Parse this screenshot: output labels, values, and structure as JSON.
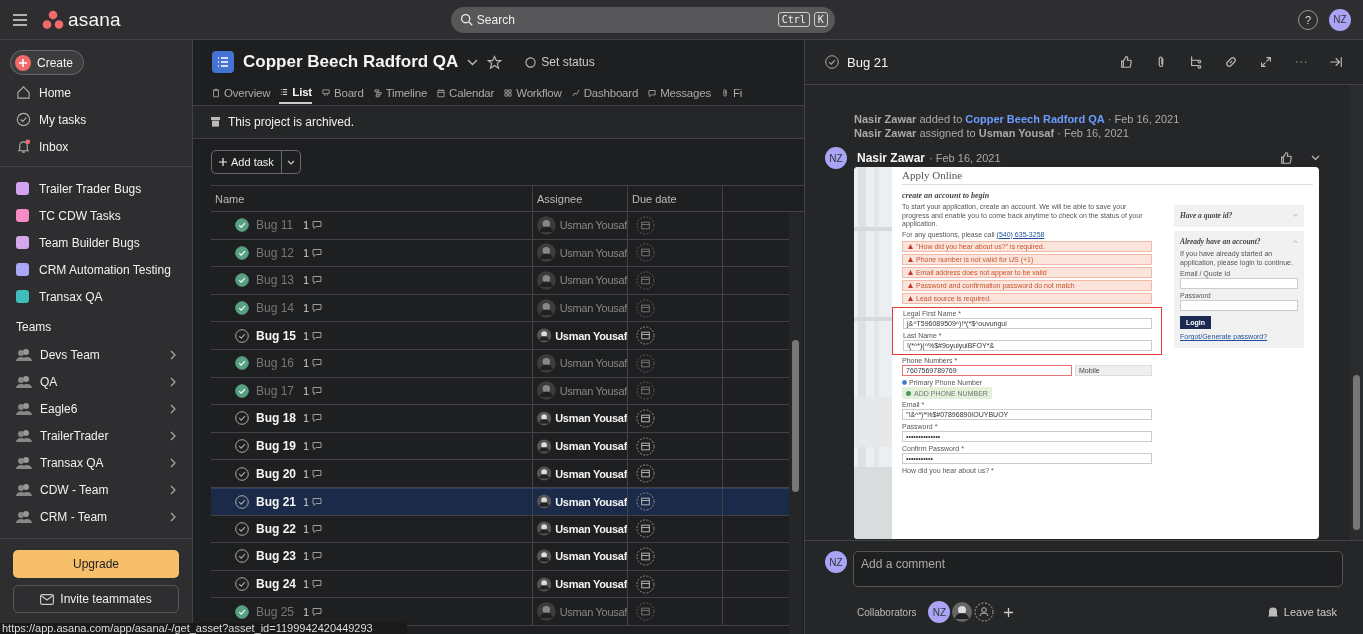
{
  "topbar": {
    "brand": "asana",
    "search_placeholder": "Search",
    "keys": [
      "Ctrl",
      "K"
    ],
    "help": "?",
    "user_initials": "NZ"
  },
  "sidebar": {
    "create": "Create",
    "nav": [
      {
        "label": "Home",
        "unread": false
      },
      {
        "label": "My tasks",
        "unread": false
      },
      {
        "label": "Inbox",
        "unread": true
      }
    ],
    "projects": [
      {
        "label": "Trailer Trader Bugs",
        "color": "#d3a4f2"
      },
      {
        "label": "TC CDW Tasks",
        "color": "#f78bc4"
      },
      {
        "label": "Team Builder Bugs",
        "color": "#d6a6ea"
      },
      {
        "label": "CRM Automation Testing",
        "color": "#a9a8f7"
      },
      {
        "label": "Transax QA",
        "color": "#3fbdbd"
      }
    ],
    "teams_heading": "Teams",
    "teams": [
      "Devs Team",
      "QA",
      "Eagle6",
      "TrailerTrader",
      "Transax QA",
      "CDW - Team",
      "CRM - Team"
    ],
    "upgrade": "Upgrade",
    "invite": "Invite teammates"
  },
  "project": {
    "title": "Copper Beech Radford QA",
    "status": "Set status",
    "tabs": [
      {
        "label": "Overview",
        "selected": false
      },
      {
        "label": "List",
        "selected": true
      },
      {
        "label": "Board",
        "selected": false
      },
      {
        "label": "Timeline",
        "selected": false
      },
      {
        "label": "Calendar",
        "selected": false
      },
      {
        "label": "Workflow",
        "selected": false
      },
      {
        "label": "Dashboard",
        "selected": false
      },
      {
        "label": "Messages",
        "selected": false
      },
      {
        "label": "Fi",
        "selected": false
      }
    ],
    "banner": "This project is archived.",
    "add_task": "Add task"
  },
  "table": {
    "columns": [
      "Name",
      "Assignee",
      "Due date"
    ],
    "rows": [
      {
        "name": "Bug 11",
        "completed": true,
        "comments": "1",
        "assignee": "Usman Yousaf",
        "selected": false
      },
      {
        "name": "Bug 12",
        "completed": true,
        "comments": "1",
        "assignee": "Usman Yousaf",
        "selected": false
      },
      {
        "name": "Bug 13",
        "completed": true,
        "comments": "1",
        "assignee": "Usman Yousaf",
        "selected": false
      },
      {
        "name": "Bug 14",
        "completed": true,
        "comments": "1",
        "assignee": "Usman Yousaf",
        "selected": false
      },
      {
        "name": "Bug 15",
        "completed": false,
        "comments": "1",
        "assignee": "Usman Yousaf",
        "selected": false
      },
      {
        "name": "Bug 16",
        "completed": true,
        "comments": "1",
        "assignee": "Usman Yousaf",
        "selected": false
      },
      {
        "name": "Bug 17",
        "completed": true,
        "comments": "1",
        "assignee": "Usman Yousaf",
        "selected": false
      },
      {
        "name": "Bug 18",
        "completed": false,
        "comments": "1",
        "assignee": "Usman Yousaf",
        "selected": false
      },
      {
        "name": "Bug 19",
        "completed": false,
        "comments": "1",
        "assignee": "Usman Yousaf",
        "selected": false
      },
      {
        "name": "Bug 20",
        "completed": false,
        "comments": "1",
        "assignee": "Usman Yousaf",
        "selected": false
      },
      {
        "name": "Bug 21",
        "completed": false,
        "comments": "1",
        "assignee": "Usman Yousaf",
        "selected": true
      },
      {
        "name": "Bug 22",
        "completed": false,
        "comments": "1",
        "assignee": "Usman Yousaf",
        "selected": false
      },
      {
        "name": "Bug 23",
        "completed": false,
        "comments": "1",
        "assignee": "Usman Yousaf",
        "selected": false
      },
      {
        "name": "Bug 24",
        "completed": false,
        "comments": "1",
        "assignee": "Usman Yousaf",
        "selected": false
      },
      {
        "name": "Bug 25",
        "completed": true,
        "comments": "1",
        "assignee": "Usman Yousaf",
        "selected": false
      }
    ]
  },
  "task": {
    "title": "Bug 21",
    "completed": false,
    "activity": [
      {
        "actor": "Nasir Zawar",
        "action": "added to",
        "target": "Copper Beech Radford QA",
        "kind": "link",
        "date": "· Feb 16, 2021"
      },
      {
        "actor": "Nasir Zawar",
        "action": "assigned to",
        "target": "Usman Yousaf",
        "kind": "person",
        "date": "· Feb 16, 2021"
      }
    ],
    "comment": {
      "initials": "NZ",
      "author": "Nasir Zawar",
      "date": "· Feb 16, 2021"
    },
    "comment_placeholder": "Add a comment",
    "my_initials": "NZ",
    "collaborators_label": "Collaborators",
    "collaborator_initials": "NZ",
    "leave": "Leave task"
  },
  "attachment": {
    "title": "Apply Online",
    "heading": "create an account to begin",
    "intro": "To start your application, create an account. We will be able to save your progress and enable you to come back anytime to check on the status of your application.",
    "call_text": "For any questions, please call",
    "call_link": "(540) 635-3258",
    "errors": [
      "\"How did you hear about us?\" is required.",
      "Phone number is not valid for US (+1)",
      "Email address does not appear to be valid",
      "Password and confirmation password do not match",
      "Lead source is required."
    ],
    "highlighted_fields": [
      {
        "label": "Legal First Name *",
        "value": "j&^T596089509^)!*(*$^ouvungui"
      },
      {
        "label": "Last Name *",
        "value": "!(*^*)(^%$#9oyuiyuiBFOY*&"
      }
    ],
    "phone": {
      "label": "Phone Numbers *",
      "value": "7607569789769",
      "type": "Mobile",
      "invalid": true
    },
    "primary": {
      "label": "Primary Phone Number",
      "checked": true
    },
    "add_phone": "ADD PHONE NUMBER",
    "fields": [
      {
        "label": "Email *",
        "value": "\"!&^*)*%$#07896890IOUYBUOY"
      },
      {
        "label": "Password *",
        "value": "••••••••••••••"
      },
      {
        "label": "Confirm Password *",
        "value": "•••••••••••"
      }
    ],
    "last_label": "How did you hear about us? *",
    "quote": "Have a quote id?",
    "login": {
      "title": "Already have an account?",
      "text": "If you have already started an application, please login to continue.",
      "email_label": "Email / Quote Id",
      "password_label": "Password",
      "button": "Login",
      "forgot": "Forgot/Generate password?"
    }
  },
  "status_url": "https://app.asana.com/app/asana/-/get_asset?asset_id=1199942420449293"
}
